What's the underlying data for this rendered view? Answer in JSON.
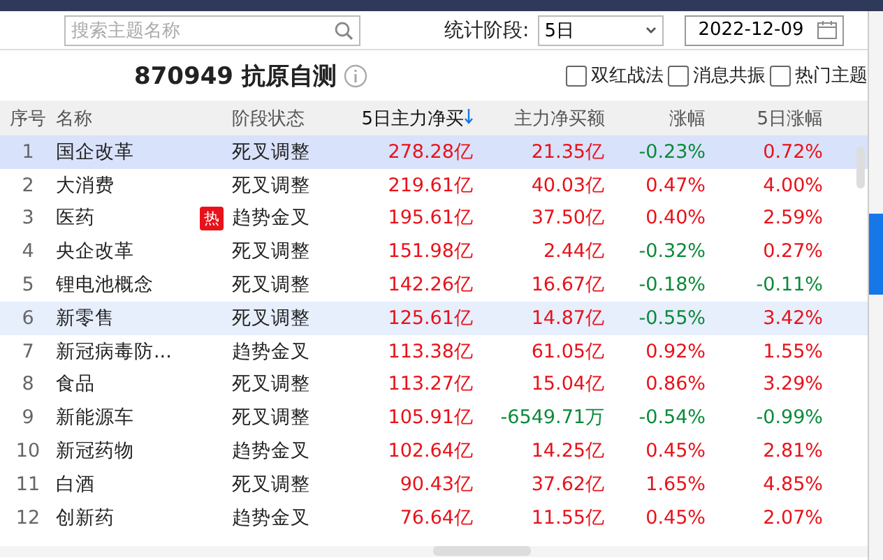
{
  "toolbar": {
    "search": {
      "placeholder": "搜索主题名称"
    },
    "period_label": "统计阶段:",
    "period": "5日",
    "date": "2022-12-09"
  },
  "title": "870949 抗原自测",
  "filters": [
    {
      "label": "双红战法",
      "checked": false
    },
    {
      "label": "消息共振",
      "checked": false
    },
    {
      "label": "热门主题",
      "checked": false
    }
  ],
  "table": {
    "columns": [
      {
        "label": "序号",
        "sorted": false
      },
      {
        "label": "名称",
        "sorted": false
      },
      {
        "label": "阶段状态",
        "sorted": false
      },
      {
        "label": "5日主力净买",
        "sorted": true
      },
      {
        "label": "主力净买额",
        "sorted": false
      },
      {
        "label": "涨幅",
        "sorted": false
      },
      {
        "label": "5日涨幅",
        "sorted": false
      }
    ],
    "rows": [
      {
        "index": "1",
        "name": "国企改革",
        "status": "死叉调整",
        "selected": true,
        "hovered": false,
        "values": [
          {
            "text": "278.28亿",
            "kind": "up"
          },
          {
            "text": "21.35亿",
            "kind": "up"
          },
          {
            "text": "-0.23%",
            "kind": "down"
          },
          {
            "text": "0.72%",
            "kind": "up"
          }
        ]
      },
      {
        "index": "2",
        "name": "大消费",
        "status": "死叉调整",
        "selected": false,
        "hovered": false,
        "values": [
          {
            "text": "219.61亿",
            "kind": "up"
          },
          {
            "text": "40.03亿",
            "kind": "up"
          },
          {
            "text": "0.47%",
            "kind": "up"
          },
          {
            "text": "4.00%",
            "kind": "up"
          }
        ]
      },
      {
        "index": "3",
        "name": "医药",
        "badge": "热",
        "status": "趋势金叉",
        "selected": false,
        "hovered": false,
        "values": [
          {
            "text": "195.61亿",
            "kind": "up"
          },
          {
            "text": "37.50亿",
            "kind": "up"
          },
          {
            "text": "0.40%",
            "kind": "up"
          },
          {
            "text": "2.59%",
            "kind": "up"
          }
        ]
      },
      {
        "index": "4",
        "name": "央企改革",
        "status": "死叉调整",
        "selected": false,
        "hovered": false,
        "values": [
          {
            "text": "151.98亿",
            "kind": "up"
          },
          {
            "text": "2.44亿",
            "kind": "up"
          },
          {
            "text": "-0.32%",
            "kind": "down"
          },
          {
            "text": "0.27%",
            "kind": "up"
          }
        ]
      },
      {
        "index": "5",
        "name": "锂电池概念",
        "status": "死叉调整",
        "selected": false,
        "hovered": false,
        "values": [
          {
            "text": "142.26亿",
            "kind": "up"
          },
          {
            "text": "16.67亿",
            "kind": "up"
          },
          {
            "text": "-0.18%",
            "kind": "down"
          },
          {
            "text": "-0.11%",
            "kind": "down"
          }
        ]
      },
      {
        "index": "6",
        "name": "新零售",
        "status": "死叉调整",
        "selected": false,
        "hovered": true,
        "values": [
          {
            "text": "125.61亿",
            "kind": "up"
          },
          {
            "text": "14.87亿",
            "kind": "up"
          },
          {
            "text": "-0.55%",
            "kind": "down"
          },
          {
            "text": "3.42%",
            "kind": "up"
          }
        ]
      },
      {
        "index": "7",
        "name": "新冠病毒防...",
        "status": "趋势金叉",
        "selected": false,
        "hovered": false,
        "values": [
          {
            "text": "113.38亿",
            "kind": "up"
          },
          {
            "text": "61.05亿",
            "kind": "up"
          },
          {
            "text": "0.92%",
            "kind": "up"
          },
          {
            "text": "1.55%",
            "kind": "up"
          }
        ]
      },
      {
        "index": "8",
        "name": "食品",
        "status": "死叉调整",
        "selected": false,
        "hovered": false,
        "values": [
          {
            "text": "113.27亿",
            "kind": "up"
          },
          {
            "text": "15.04亿",
            "kind": "up"
          },
          {
            "text": "0.86%",
            "kind": "up"
          },
          {
            "text": "3.29%",
            "kind": "up"
          }
        ]
      },
      {
        "index": "9",
        "name": "新能源车",
        "status": "死叉调整",
        "selected": false,
        "hovered": false,
        "values": [
          {
            "text": "105.91亿",
            "kind": "up"
          },
          {
            "text": "-6549.71万",
            "kind": "down"
          },
          {
            "text": "-0.54%",
            "kind": "down"
          },
          {
            "text": "-0.99%",
            "kind": "down"
          }
        ]
      },
      {
        "index": "10",
        "name": "新冠药物",
        "status": "趋势金叉",
        "selected": false,
        "hovered": false,
        "values": [
          {
            "text": "102.64亿",
            "kind": "up"
          },
          {
            "text": "14.25亿",
            "kind": "up"
          },
          {
            "text": "0.45%",
            "kind": "up"
          },
          {
            "text": "2.81%",
            "kind": "up"
          }
        ]
      },
      {
        "index": "11",
        "name": "白酒",
        "status": "死叉调整",
        "selected": false,
        "hovered": false,
        "values": [
          {
            "text": "90.43亿",
            "kind": "up"
          },
          {
            "text": "37.62亿",
            "kind": "up"
          },
          {
            "text": "1.65%",
            "kind": "up"
          },
          {
            "text": "4.85%",
            "kind": "up"
          }
        ]
      },
      {
        "index": "12",
        "name": "创新药",
        "status": "趋势金叉",
        "selected": false,
        "hovered": false,
        "values": [
          {
            "text": "76.64亿",
            "kind": "up"
          },
          {
            "text": "11.55亿",
            "kind": "up"
          },
          {
            "text": "0.45%",
            "kind": "up"
          },
          {
            "text": "2.07%",
            "kind": "up"
          }
        ]
      }
    ]
  }
}
